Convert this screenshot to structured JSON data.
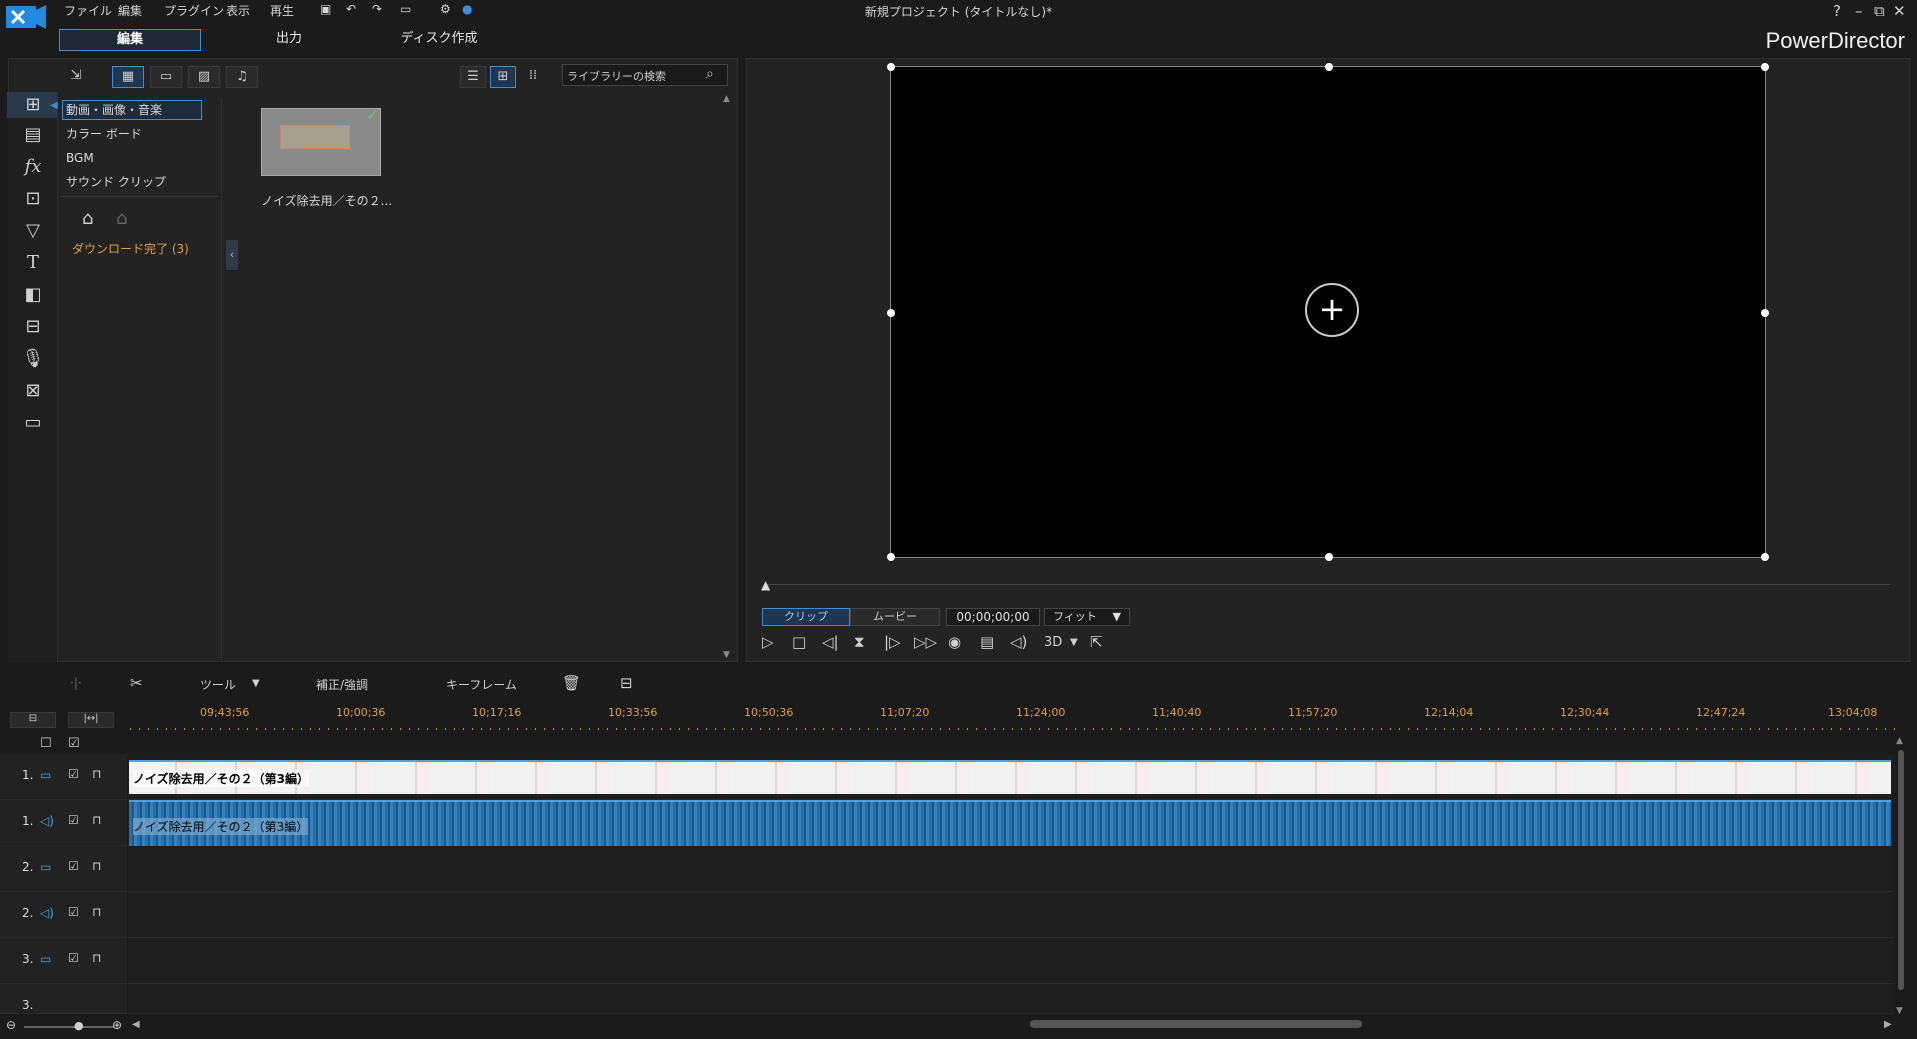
{
  "app": {
    "title": "新規プロジェクト (タイトルなし)*",
    "brand": "PowerDirector"
  },
  "menu": [
    "ファイル",
    "編集",
    "プラグイン",
    "表示",
    "再生"
  ],
  "window_controls": [
    "?",
    "–",
    "⧉",
    "✕"
  ],
  "mode_tabs": [
    "編集",
    "出力",
    "ディスク作成"
  ],
  "library": {
    "search_placeholder": "ライブラリーの検索",
    "tree": [
      "動画・画像・音楽",
      "カラー ボード",
      "BGM",
      "サウンド クリップ"
    ],
    "download_label": "ダウンロード完了 (3)",
    "media": [
      {
        "label": "ノイズ除去用／その２..."
      }
    ]
  },
  "preview": {
    "clip_label": "クリップ",
    "movie_label": "ムービー",
    "timecode": "00;00;00;00",
    "fit_label": "フィット",
    "threed_label": "3D"
  },
  "timeline": {
    "tools_label": "ツール",
    "fix_label": "補正/強調",
    "keyframe_label": "キーフレーム",
    "ticks": [
      "09;43;56",
      "10;00;36",
      "10;17;16",
      "10;33;56",
      "10;50;36",
      "11;07;20",
      "11;24;00",
      "11;40;40",
      "11;57;20",
      "12;14;04",
      "12;30;44",
      "12;47;24",
      "13;04;08"
    ],
    "tracks": [
      "1.",
      "1.",
      "2.",
      "2.",
      "3.",
      "3."
    ],
    "video_clip_label": "ノイズ除去用／その２（第3編）",
    "audio_clip_label": "ノイズ除去用／その２（第3編）"
  }
}
